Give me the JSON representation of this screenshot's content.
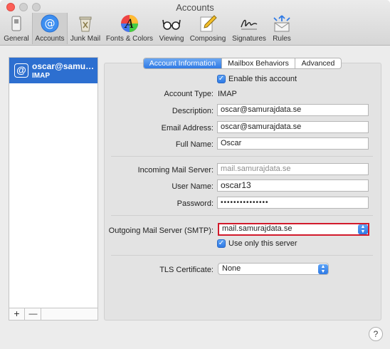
{
  "window": {
    "title": "Accounts"
  },
  "toolbar": {
    "items": [
      {
        "label": "General",
        "icon": "general-switch-icon"
      },
      {
        "label": "Accounts",
        "icon": "at-sign-icon",
        "selected": true
      },
      {
        "label": "Junk Mail",
        "icon": "junk-trash-icon"
      },
      {
        "label": "Fonts & Colors",
        "icon": "fonts-colors-icon"
      },
      {
        "label": "Viewing",
        "icon": "glasses-icon"
      },
      {
        "label": "Composing",
        "icon": "pencil-icon"
      },
      {
        "label": "Signatures",
        "icon": "signature-icon"
      },
      {
        "label": "Rules",
        "icon": "rules-envelope-icon"
      }
    ]
  },
  "sidebar": {
    "accounts": [
      {
        "name": "oscar@samur…",
        "type": "IMAP",
        "selected": true
      }
    ],
    "add_label": "+",
    "remove_label": "—"
  },
  "tabs": [
    {
      "label": "Account Information",
      "active": true
    },
    {
      "label": "Mailbox Behaviors",
      "active": false
    },
    {
      "label": "Advanced",
      "active": false
    }
  ],
  "form": {
    "enable_account": {
      "label": "Enable this account",
      "checked": true
    },
    "account_type": {
      "label": "Account Type:",
      "value": "IMAP"
    },
    "description": {
      "label": "Description:",
      "value": "oscar@samurajdata.se"
    },
    "email": {
      "label": "Email Address:",
      "value": "oscar@samurajdata.se"
    },
    "full_name": {
      "label": "Full Name:",
      "value": "Oscar"
    },
    "incoming_server": {
      "label": "Incoming Mail Server:",
      "value": "mail.samurajdata.se"
    },
    "user_name": {
      "label": "User Name:",
      "value": "oscar13"
    },
    "password": {
      "label": "Password:",
      "value": "•••••••••••••••"
    },
    "outgoing_server": {
      "label": "Outgoing Mail Server (SMTP):",
      "value": "mail.samurajdata.se"
    },
    "use_only_server": {
      "label": "Use only this server",
      "checked": true
    },
    "tls_certificate": {
      "label": "TLS Certificate:",
      "value": "None"
    }
  },
  "help": {
    "label": "?"
  },
  "colors": {
    "accent": "#2f7ae5",
    "selection": "#2d6fd0",
    "highlight_border": "#d21a2b"
  }
}
